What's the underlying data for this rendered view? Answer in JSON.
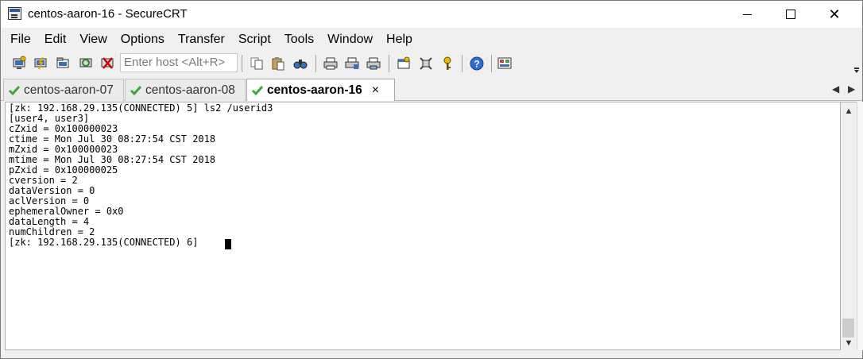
{
  "window": {
    "title": "centos-aaron-16 - SecureCRT",
    "close_glyph": "✕"
  },
  "menu": [
    "File",
    "Edit",
    "View",
    "Options",
    "Transfer",
    "Script",
    "Tools",
    "Window",
    "Help"
  ],
  "toolbar": {
    "host_placeholder": "Enter host <Alt+R>",
    "icons": [
      "connect-icon",
      "quick-connect-icon",
      "connect-tab-icon",
      "reconnect-icon",
      "disconnect-icon",
      "copy-icon",
      "paste-icon",
      "find-icon",
      "print-icon",
      "print-setup-icon",
      "print-screen-icon",
      "session-options-icon",
      "keymap-icon",
      "key-agent-icon",
      "help-icon",
      "sftp-icon"
    ]
  },
  "tabs": [
    {
      "label": "centos-aaron-07",
      "active": false
    },
    {
      "label": "centos-aaron-08",
      "active": false
    },
    {
      "label": "centos-aaron-16",
      "active": true
    }
  ],
  "tab_close_glyph": "×",
  "tab_nav": {
    "prev": "◀",
    "next": "▶"
  },
  "scroll": {
    "up": "▲",
    "down": "▼"
  },
  "terminal": {
    "lines": [
      "[zk: 192.168.29.135(CONNECTED) 5] ls2 /userid3",
      "[user4, user3]",
      "cZxid = 0x100000023",
      "ctime = Mon Jul 30 08:27:54 CST 2018",
      "mZxid = 0x100000023",
      "mtime = Mon Jul 30 08:27:54 CST 2018",
      "pZxid = 0x100000025",
      "cversion = 2",
      "dataVersion = 0",
      "aclVersion = 0",
      "ephemeralOwner = 0x0",
      "dataLength = 4",
      "numChildren = 2",
      "[zk: 192.168.29.135(CONNECTED) 6] "
    ]
  },
  "colors": {
    "check": "#3aa83a",
    "title_bar": "#ffffff",
    "chrome": "#f0f0f0"
  }
}
